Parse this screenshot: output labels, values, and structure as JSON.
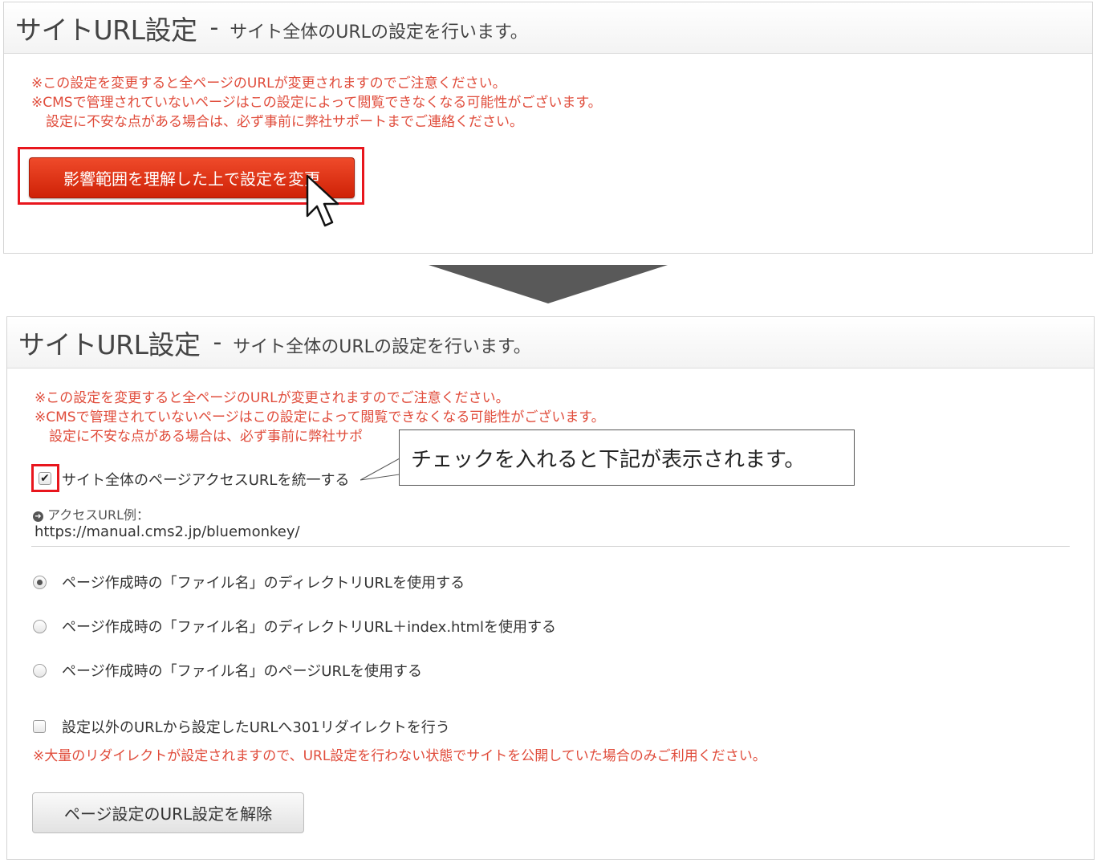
{
  "top_panel": {
    "title": "サイトURL設定",
    "dash": "-",
    "subtitle": "サイト全体のURLの設定を行います。",
    "warnings": [
      "※この設定を変更すると全ページのURLが変更されますのでご注意ください。",
      "※CMSで管理されていないページはこの設定によって閲覧できなくなる可能性がございます。",
      "設定に不安な点がある場合は、必ず事前に弊社サポートまでご連絡ください。"
    ],
    "change_button": "影響範囲を理解した上で設定を変更"
  },
  "bottom_panel": {
    "title": "サイトURL設定",
    "dash": "-",
    "subtitle": "サイト全体のURLの設定を行います。",
    "warnings": [
      "※この設定を変更すると全ページのURLが変更されますのでご注意ください。",
      "※CMSで管理されていないページはこの設定によって閲覧できなくなる可能性がございます。",
      "設定に不安な点がある場合は、必ず事前に弊社サポ"
    ],
    "unify_checkbox_label": "サイト全体のページアクセスURLを統一する",
    "unify_checked": true,
    "callout": "チェックを入れると下記が表示されます。",
    "access_url_label": "アクセスURL例：",
    "access_url_value": "https://manual.cms2.jp/bluemonkey/",
    "radio_options": [
      "ページ作成時の「ファイル名」のディレクトリURLを使用する",
      "ページ作成時の「ファイル名」のディレクトリURL＋index.htmlを使用する",
      "ページ作成時の「ファイル名」のページURLを使用する"
    ],
    "radio_selected": "ページ作成時の「ファイル名」のディレクトリURLを使用する",
    "redirect_label": "設定以外のURLから設定したURLへ301リダイレクトを行う",
    "redirect_checked": false,
    "redirect_warning": "※大量のリダイレクトが設定されますので、URL設定を行わない状態でサイトを公開していた場合のみご利用ください。",
    "release_button": "ページ設定のURL設定を解除"
  },
  "colors": {
    "accent_red": "#e8161d",
    "warning_text": "#e04c3b",
    "button_red": "#d9290d"
  },
  "icons": {
    "cursor": "arrow-pointer-icon",
    "flow": "down-triangle-icon",
    "info": "circle-arrow-right-icon"
  }
}
